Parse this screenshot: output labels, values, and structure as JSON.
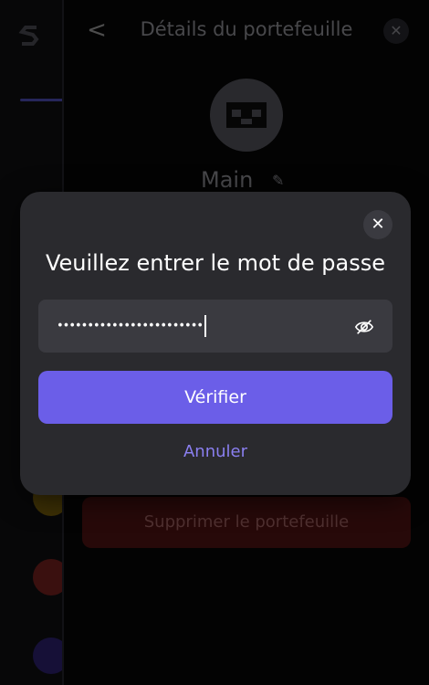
{
  "background_app": {
    "logo_letter": "S",
    "coins": [
      {
        "icon": "gold-coin-icon",
        "color": "#b08a10"
      },
      {
        "icon": "avalanche-icon",
        "color": "#b3302b"
      },
      {
        "icon": "purple-coin-icon",
        "color": "#3a2b86"
      }
    ]
  },
  "drawer": {
    "back_symbol": "<",
    "title": "Détails du portefeuille",
    "close_symbol": "✕",
    "wallet_name": "Main",
    "edit_symbol": "✎",
    "delete_label": "Supprimer le portefeuille"
  },
  "modal": {
    "close_symbol": "✕",
    "title": "Veuillez entrer le mot de passe",
    "password_value": "••••••••••••••••••••••••",
    "verify_label": "Vérifier",
    "cancel_label": "Annuler"
  },
  "colors": {
    "accent": "#6b5ee8",
    "link": "#8a7ff0",
    "danger": "#3d0e0e",
    "modal_bg": "#2a2a2e"
  }
}
